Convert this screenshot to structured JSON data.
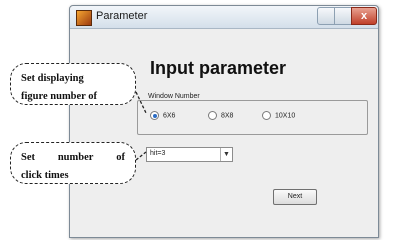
{
  "window": {
    "title": "Parameter",
    "close_label": "x"
  },
  "main": {
    "heading": "Input parameter",
    "group_label": "Window Number",
    "options": [
      {
        "label": "6X6",
        "selected": true
      },
      {
        "label": "8X8",
        "selected": false
      },
      {
        "label": "10X10",
        "selected": false
      }
    ],
    "click_times_value": "hit=3",
    "next_label": "Next"
  },
  "annotations": {
    "callout1": {
      "line1": "Set displaying",
      "line2": "figure number of"
    },
    "callout2": {
      "line1_a": "Set",
      "line1_b": "number",
      "line1_c": "of",
      "line2": "click times"
    }
  }
}
